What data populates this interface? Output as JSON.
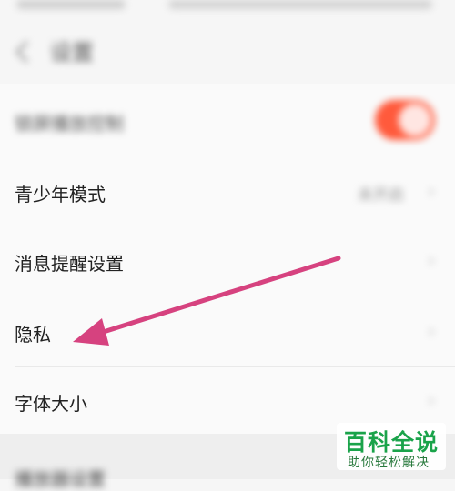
{
  "header": {
    "title": "设置"
  },
  "rows": [
    {
      "label": "锁屏播放控制",
      "toggle_on": true
    },
    {
      "label": "青少年模式",
      "value": "未开启"
    },
    {
      "label": "消息提醒设置"
    },
    {
      "label": "隐私"
    },
    {
      "label": "字体大小"
    }
  ],
  "section": {
    "title": "播放器设置"
  },
  "icons": {
    "back": "chevron-left-icon",
    "row_chevron": "chevron-right-icon"
  },
  "colors": {
    "toggle_on": "#ff5a3c",
    "annotation_arrow": "#d6427f",
    "watermark_green": "#1aa34a"
  },
  "watermark": {
    "title": "百科全说",
    "subtitle": "助你轻松解决"
  }
}
